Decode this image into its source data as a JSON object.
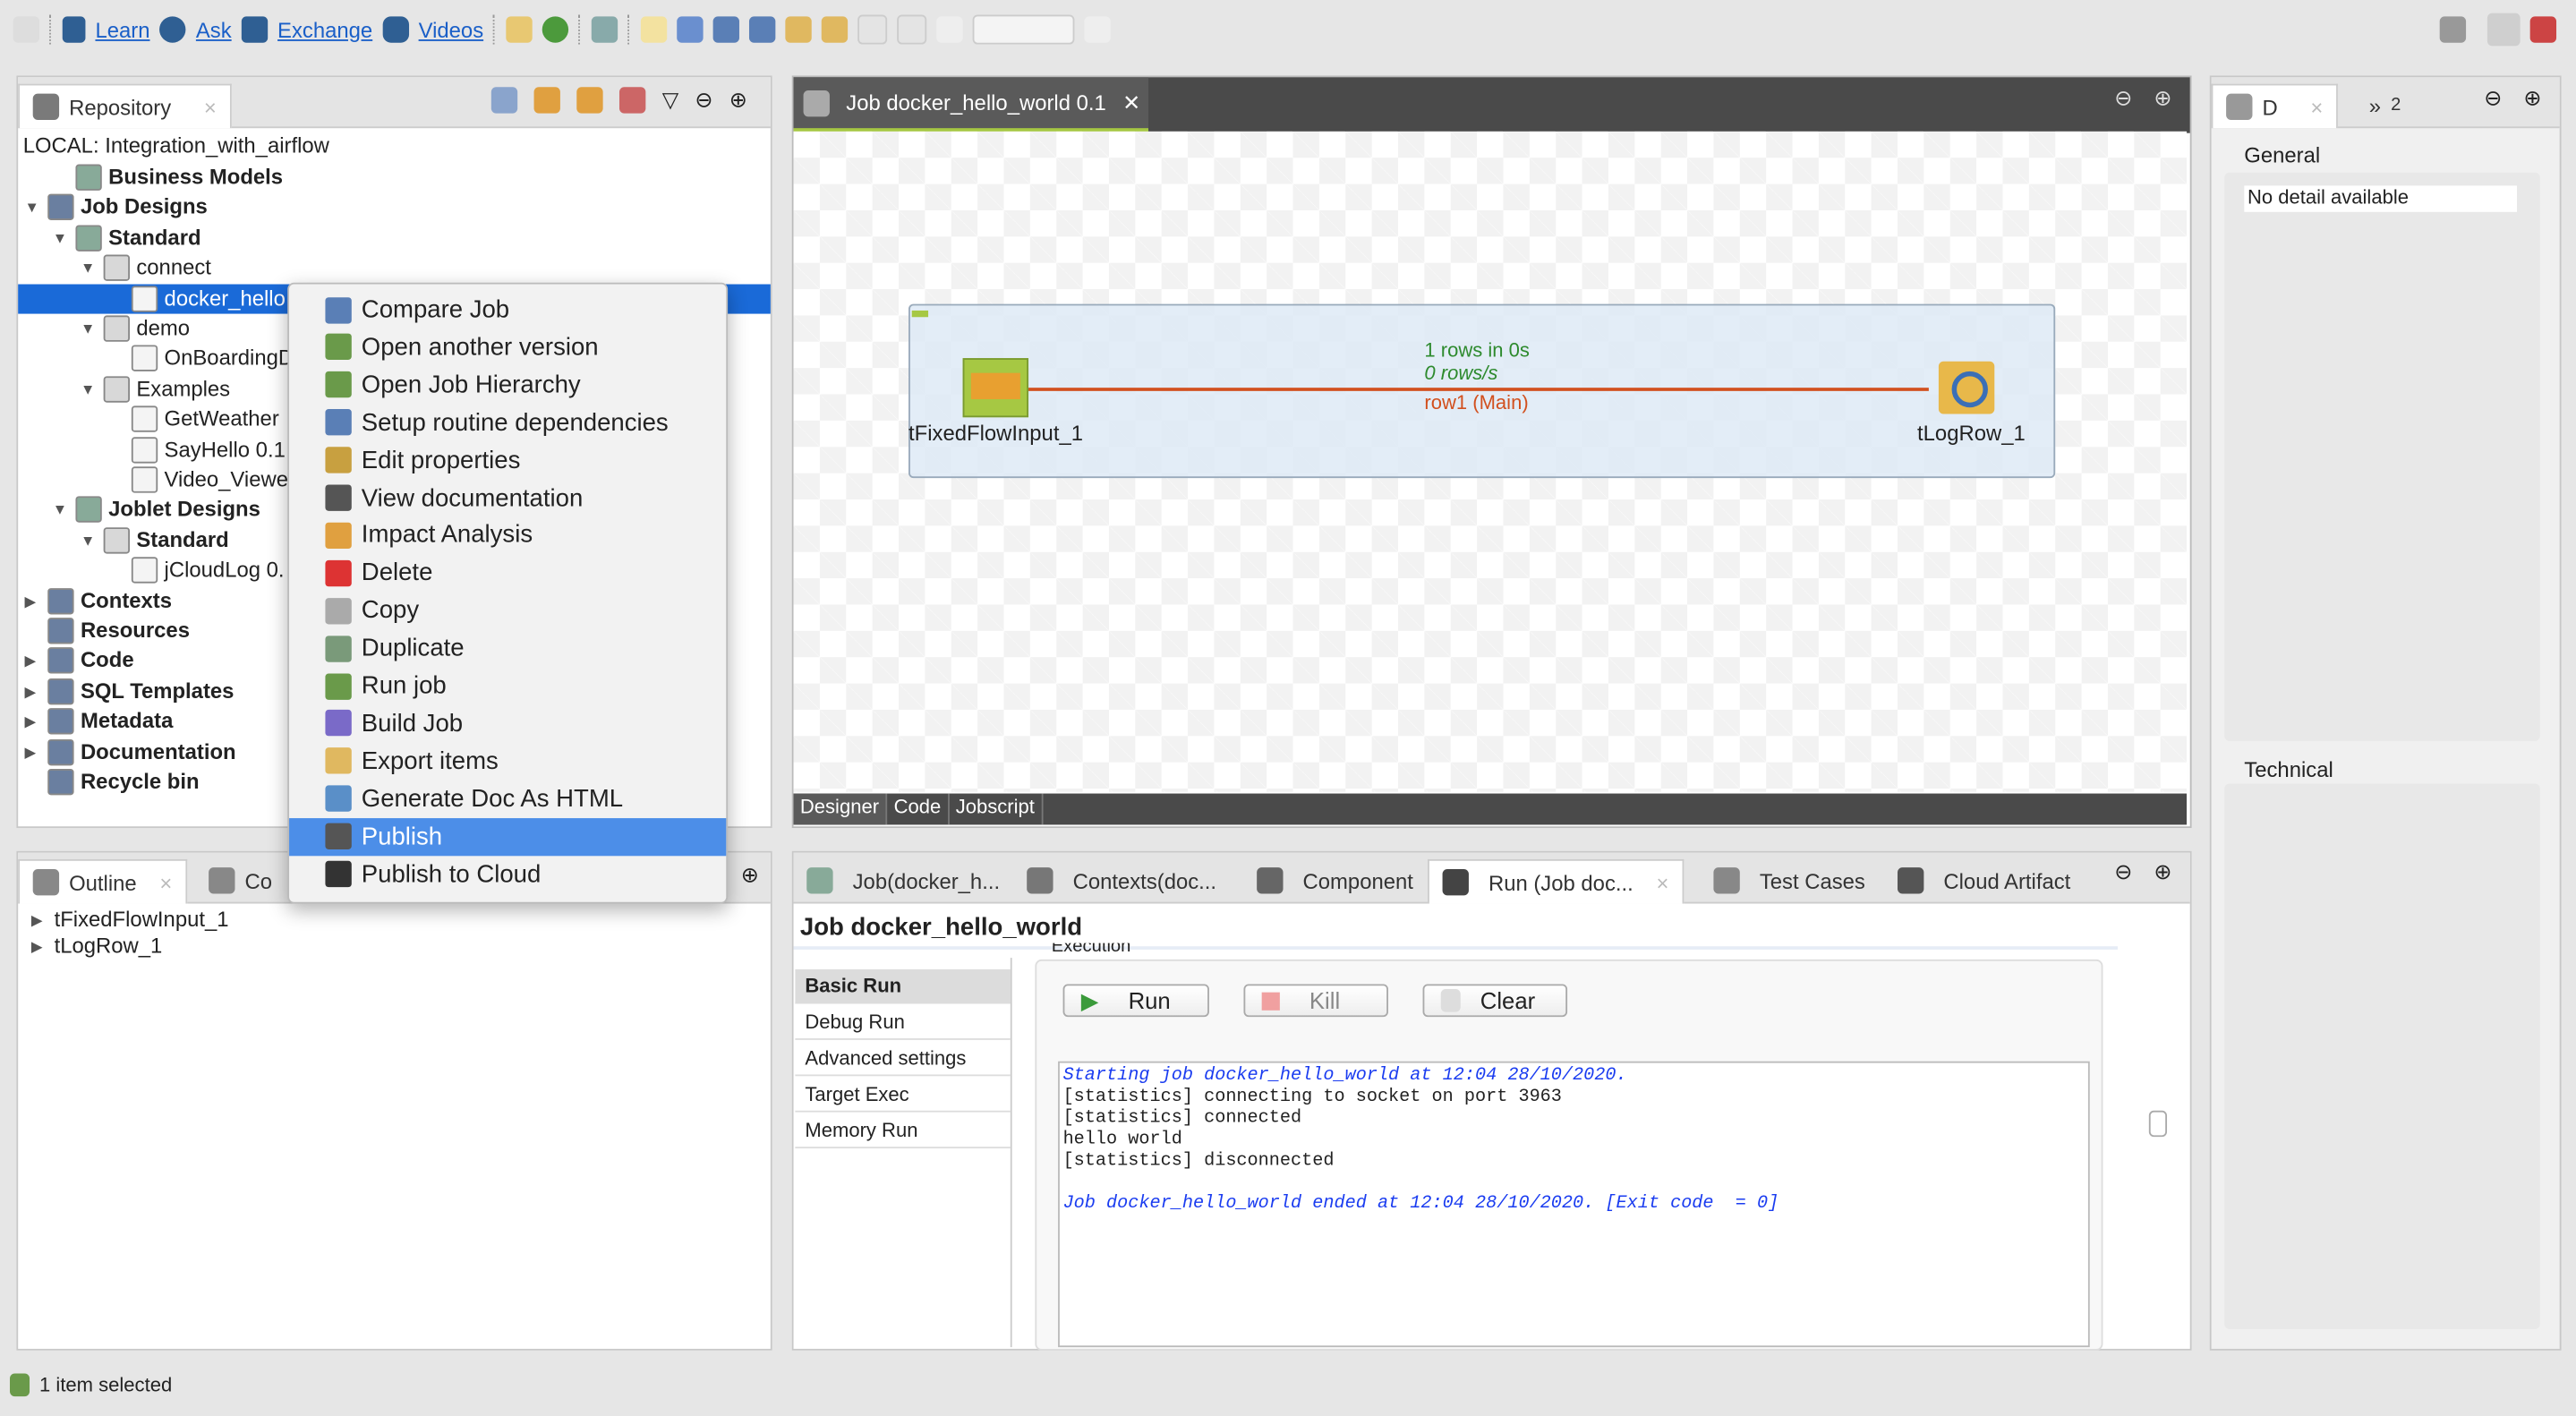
{
  "toolbar": {
    "links": [
      "Learn",
      "Ask",
      "Exchange",
      "Videos"
    ]
  },
  "repository": {
    "tab": "Repository",
    "root": "LOCAL: Integration_with_airflow",
    "items": [
      {
        "label": "Business Models",
        "bold": true,
        "level": 1,
        "toggle": ""
      },
      {
        "label": "Job Designs",
        "bold": true,
        "level": 0,
        "toggle": "▼"
      },
      {
        "label": "Standard",
        "bold": true,
        "level": 1,
        "toggle": "▼"
      },
      {
        "label": "connect",
        "bold": false,
        "level": 2,
        "toggle": "▼"
      },
      {
        "label": "docker_hello",
        "bold": false,
        "level": 3,
        "toggle": "",
        "selected": true
      },
      {
        "label": "demo",
        "bold": false,
        "level": 2,
        "toggle": "▼"
      },
      {
        "label": "OnBoardingD",
        "bold": false,
        "level": 3,
        "toggle": ""
      },
      {
        "label": "Examples",
        "bold": false,
        "level": 2,
        "toggle": "▼"
      },
      {
        "label": "GetWeather",
        "bold": false,
        "level": 3,
        "toggle": ""
      },
      {
        "label": "SayHello 0.1",
        "bold": false,
        "level": 3,
        "toggle": ""
      },
      {
        "label": "Video_Viewe",
        "bold": false,
        "level": 3,
        "toggle": ""
      },
      {
        "label": "Joblet Designs",
        "bold": true,
        "level": 1,
        "toggle": "▼"
      },
      {
        "label": "Standard",
        "bold": true,
        "level": 2,
        "toggle": "▼"
      },
      {
        "label": "jCloudLog 0.",
        "bold": false,
        "level": 3,
        "toggle": ""
      },
      {
        "label": "Contexts",
        "bold": true,
        "level": 0,
        "toggle": "▶"
      },
      {
        "label": "Resources",
        "bold": true,
        "level": 0,
        "toggle": ""
      },
      {
        "label": "Code",
        "bold": true,
        "level": 0,
        "toggle": "▶"
      },
      {
        "label": "SQL Templates",
        "bold": true,
        "level": 0,
        "toggle": "▶"
      },
      {
        "label": "Metadata",
        "bold": true,
        "level": 0,
        "toggle": "▶"
      },
      {
        "label": "Documentation",
        "bold": true,
        "level": 0,
        "toggle": "▶"
      },
      {
        "label": "Recycle bin",
        "bold": true,
        "level": 0,
        "toggle": ""
      }
    ]
  },
  "context_menu": {
    "items": [
      "Compare Job",
      "Open another version",
      "Open Job Hierarchy",
      "Setup routine dependencies",
      "Edit properties",
      "View documentation",
      "Impact Analysis",
      "Delete",
      "Copy",
      "Duplicate",
      "Run job",
      "Build Job",
      "Export items",
      "Generate Doc As HTML",
      "Publish",
      "Publish to Cloud"
    ],
    "selected": "Publish"
  },
  "outline": {
    "tabs": [
      "Outline",
      "Co"
    ],
    "items": [
      "tFixedFlowInput_1",
      "tLogRow_1"
    ]
  },
  "editor": {
    "tab": "Job docker_hello_world 0.1",
    "components": {
      "input": "tFixedFlowInput_1",
      "output": "tLogRow_1"
    },
    "link": {
      "stats1": "1 rows in 0s",
      "stats2": "0 rows/s",
      "label": "row1 (Main)"
    },
    "bottom_tabs": [
      "Designer",
      "Code",
      "Jobscript"
    ]
  },
  "bottom": {
    "tabs": [
      "Job(docker_h...",
      "Contexts(doc...",
      "Component",
      "Run (Job doc...",
      "Test Cases",
      "Cloud Artifact"
    ],
    "title": "Job docker_hello_world",
    "section": "Execution",
    "side": [
      "Basic Run",
      "Debug Run",
      "Advanced settings",
      "Target Exec",
      "Memory Run"
    ],
    "buttons": {
      "run": "Run",
      "kill": "Kill",
      "clear": "Clear"
    },
    "console": [
      {
        "text": "Starting job docker_hello_world at 12:04 28/10/2020.",
        "style": "blue"
      },
      {
        "text": "[statistics] connecting to socket on port 3963",
        "style": ""
      },
      {
        "text": "[statistics] connected",
        "style": ""
      },
      {
        "text": "hello world",
        "style": ""
      },
      {
        "text": "[statistics] disconnected",
        "style": ""
      },
      {
        "text": " ",
        "style": ""
      },
      {
        "text": "Job docker_hello_world ended at 12:04 28/10/2020. [Exit code  = 0]",
        "style": "blue"
      }
    ]
  },
  "right": {
    "tab1": "D",
    "tab2": "2",
    "general": "General",
    "no_detail": "No detail available",
    "technical": "Technical"
  },
  "status": {
    "text": "1 item selected"
  },
  "colors": {
    "selection": "#1a6ad8",
    "menu_selected": "#4c8ee8",
    "link": "#d2501e",
    "stats": "#2d8a2d",
    "accent_green": "#a6c843"
  }
}
